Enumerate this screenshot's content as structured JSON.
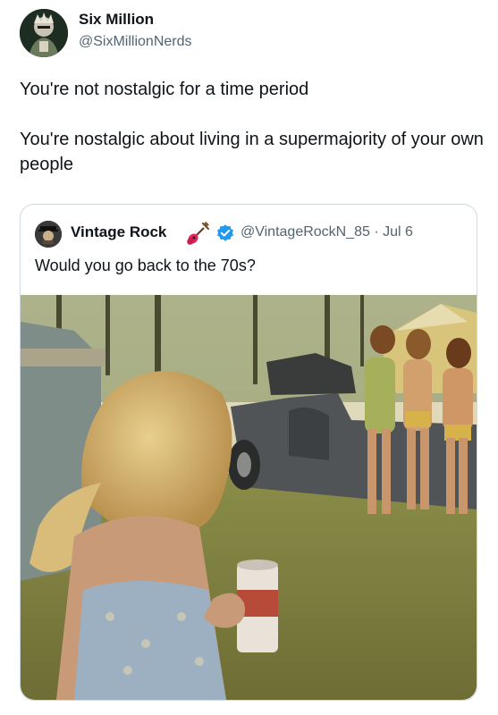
{
  "tweet": {
    "author_name": "Six Million",
    "author_handle": "@SixMillionNerds",
    "text_line_1": "You're not nostalgic for a time period",
    "text_line_2": "You're nostalgic about living in a supermajority of your own people"
  },
  "quoted_tweet": {
    "author_name": "Vintage Rock",
    "author_handle": "@VintageRockN_85",
    "separator": "·",
    "date": "Jul 6",
    "text": "Would you go back to the 70s?",
    "badge_icon": "guitar-icon",
    "verified_icon": "verified-badge-icon"
  },
  "colors": {
    "text_primary": "#0f1419",
    "text_secondary": "#536471",
    "border": "#cfd9de",
    "verified_blue": "#1d9bf0"
  }
}
